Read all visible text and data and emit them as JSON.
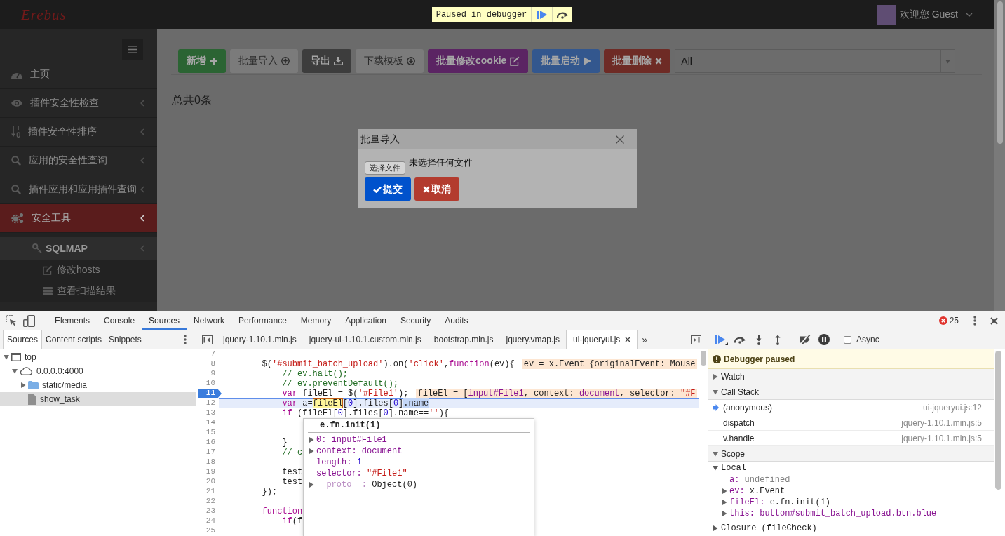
{
  "page": {
    "logo": "Erebus",
    "debugger_overlay": {
      "text": "Paused in debugger"
    },
    "user": {
      "greeting": "欢迎您 Guest"
    },
    "sidebar": {
      "items": [
        {
          "label": "主页",
          "kind": "link",
          "selected": false
        },
        {
          "label": "插件安全性检查",
          "kind": "menu",
          "selected": false
        },
        {
          "label": "插件安全性排序",
          "kind": "menu",
          "selected": false
        },
        {
          "label": "应用的安全性查询",
          "kind": "menu",
          "selected": false
        },
        {
          "label": "插件应用和应用插件查询",
          "kind": "menu",
          "selected": false
        },
        {
          "label": "安全工具",
          "kind": "menu",
          "selected": true,
          "children": [
            {
              "label": "SQLMAP",
              "kind": "menu",
              "selected": false,
              "children": [
                {
                  "label": "修改hosts",
                  "kind": "link",
                  "selected": false
                },
                {
                  "label": "查看扫描结果",
                  "kind": "link",
                  "selected": false
                }
              ]
            }
          ]
        }
      ]
    },
    "toolbar": {
      "buttons": [
        {
          "label": "新增",
          "kind": "solid",
          "color": "#2b6433"
        },
        {
          "label": "批量导入",
          "kind": "default",
          "color": "#7b7b7b"
        },
        {
          "label": "导出",
          "kind": "solid",
          "color": "#3d3d3d"
        },
        {
          "label": "下载模板",
          "kind": "default",
          "color": "#7b7b7b"
        },
        {
          "label": "批量修改cookie",
          "kind": "solid",
          "color": "#5b2463"
        },
        {
          "label": "批量启动",
          "kind": "solid",
          "color": "#33578e"
        },
        {
          "label": "批量删除",
          "kind": "solid",
          "color": "#6e2b25"
        }
      ],
      "filter": {
        "value": "All"
      }
    },
    "total": "总共0条",
    "dialog": {
      "title": "批量导入",
      "file_button": "选择文件",
      "file_status": "未选择任何文件",
      "buttons": [
        {
          "label": "提交",
          "color": "#0052cc"
        },
        {
          "label": "取消",
          "color": "#b33b2e"
        }
      ]
    }
  },
  "devtools": {
    "tabs": [
      {
        "label": "Elements",
        "selected": false
      },
      {
        "label": "Console",
        "selected": false
      },
      {
        "label": "Sources",
        "selected": true
      },
      {
        "label": "Network",
        "selected": false
      },
      {
        "label": "Performance",
        "selected": false
      },
      {
        "label": "Memory",
        "selected": false
      },
      {
        "label": "Application",
        "selected": false
      },
      {
        "label": "Security",
        "selected": false
      },
      {
        "label": "Audits",
        "selected": false
      }
    ],
    "error_count": "25",
    "navigator": {
      "tabs": [
        {
          "label": "Sources",
          "selected": true
        },
        {
          "label": "Content scripts",
          "selected": false
        },
        {
          "label": "Snippets",
          "selected": false
        }
      ],
      "tree": [
        {
          "label": "top",
          "kind": "frame",
          "expanded": true,
          "selected": false,
          "children": [
            {
              "label": "0.0.0.0:4000",
              "kind": "domain",
              "expanded": true,
              "selected": false,
              "children": [
                {
                  "label": "static/media",
                  "kind": "folder",
                  "expanded": false,
                  "selected": false
                },
                {
                  "label": "show_task",
                  "kind": "file",
                  "selected": true
                }
              ]
            }
          ]
        }
      ]
    },
    "editor": {
      "files": [
        {
          "label": "jquery-1.10.1.min.js",
          "selected": false
        },
        {
          "label": "jquery-ui-1.10.1.custom.min.js",
          "selected": false
        },
        {
          "label": "bootstrap.min.js",
          "selected": false
        },
        {
          "label": "jquery.vmap.js",
          "selected": false
        },
        {
          "label": "ui-jqueryui.js",
          "selected": true
        }
      ],
      "overflow": "»",
      "lines": [
        {
          "number": "7",
          "breakpoint": false,
          "current": false
        },
        {
          "number": "8",
          "breakpoint": false,
          "current": false,
          "code": [
            {
              "kind": "plain",
              "text": "        $("
            },
            {
              "kind": "string",
              "text": "'#submit_batch_upload'"
            },
            {
              "kind": "plain",
              "text": ").on("
            },
            {
              "kind": "string",
              "text": "'click'"
            },
            {
              "kind": "plain",
              "text": ","
            },
            {
              "kind": "keyword",
              "text": "function"
            },
            {
              "kind": "plain",
              "text": "(ev){"
            }
          ],
          "inline_value": [
            {
              "kind": "plain",
              "text": "ev = x.Event {originalEvent: Mouse"
            }
          ]
        },
        {
          "number": "9",
          "breakpoint": false,
          "current": false,
          "code": [
            {
              "kind": "comment",
              "text": "            // ev.halt();"
            }
          ]
        },
        {
          "number": "10",
          "breakpoint": false,
          "current": false,
          "code": [
            {
              "kind": "comment",
              "text": "            // ev.preventDefault();"
            }
          ]
        },
        {
          "number": "11",
          "breakpoint": true,
          "current": false,
          "code": [
            {
              "kind": "keyword",
              "text": "            var"
            },
            {
              "kind": "plain",
              "text": " fileEl = $("
            },
            {
              "kind": "string",
              "text": "'#File1'"
            },
            {
              "kind": "plain",
              "text": ");"
            }
          ],
          "inline_value": [
            {
              "kind": "plain",
              "text": "fileEl = ["
            },
            {
              "kind": "node",
              "text": "input#File1"
            },
            {
              "kind": "plain",
              "text": ", context: "
            },
            {
              "kind": "node",
              "text": "document"
            },
            {
              "kind": "plain",
              "text": ", selector: "
            },
            {
              "kind": "string",
              "text": "\"#F"
            }
          ]
        },
        {
          "number": "12",
          "breakpoint": false,
          "current": true,
          "code": [
            {
              "kind": "keyword",
              "text": "            var"
            },
            {
              "kind": "plain",
              "text": " a="
            },
            {
              "kind": "hovered",
              "text": "fileEl"
            },
            {
              "kind": "plain",
              "text": "["
            },
            {
              "kind": "number",
              "text": "0"
            },
            {
              "kind": "plain",
              "text": "].files["
            },
            {
              "kind": "number",
              "text": "0"
            },
            {
              "kind": "plain",
              "text": "]"
            },
            {
              "kind": "selection",
              "text": ".name"
            }
          ]
        },
        {
          "number": "13",
          "breakpoint": false,
          "current": false,
          "code": [
            {
              "kind": "keyword",
              "text": "            if"
            },
            {
              "kind": "plain",
              "text": " (fileEl["
            },
            {
              "kind": "number",
              "text": "0"
            },
            {
              "kind": "plain",
              "text": "].files["
            },
            {
              "kind": "number",
              "text": "0"
            },
            {
              "kind": "plain",
              "text": "].name=="
            },
            {
              "kind": "string",
              "text": "''"
            },
            {
              "kind": "plain",
              "text": "){"
            }
          ]
        },
        {
          "number": "14",
          "breakpoint": false,
          "current": false
        },
        {
          "number": "15",
          "breakpoint": false,
          "current": false
        },
        {
          "number": "16",
          "breakpoint": false,
          "current": false,
          "code": [
            {
              "kind": "plain",
              "text": "            }"
            }
          ]
        },
        {
          "number": "17",
          "breakpoint": false,
          "current": false,
          "code": [
            {
              "kind": "comment",
              "text": "            // c"
            }
          ]
        },
        {
          "number": "18",
          "breakpoint": false,
          "current": false
        },
        {
          "number": "19",
          "breakpoint": false,
          "current": false,
          "code": [
            {
              "kind": "plain",
              "text": "            test"
            }
          ]
        },
        {
          "number": "20",
          "breakpoint": false,
          "current": false,
          "code": [
            {
              "kind": "plain",
              "text": "            test"
            }
          ]
        },
        {
          "number": "21",
          "breakpoint": false,
          "current": false,
          "code": [
            {
              "kind": "plain",
              "text": "        });"
            }
          ]
        },
        {
          "number": "22",
          "breakpoint": false,
          "current": false
        },
        {
          "number": "23",
          "breakpoint": false,
          "current": false,
          "code": [
            {
              "kind": "keyword",
              "text": "        function"
            }
          ]
        },
        {
          "number": "24",
          "breakpoint": false,
          "current": false,
          "code": [
            {
              "kind": "keyword",
              "text": "            if"
            },
            {
              "kind": "plain",
              "text": "(f"
            }
          ]
        },
        {
          "number": "25",
          "breakpoint": false,
          "current": false
        }
      ],
      "popover": {
        "title": "e.fn.init(1)",
        "entries": [
          {
            "key": "0:",
            "value": "input#File1",
            "kind": "node",
            "expandable": true,
            "internal": false
          },
          {
            "key": "context:",
            "value": "document",
            "kind": "node",
            "expandable": true,
            "internal": false
          },
          {
            "key": "length:",
            "value": "1",
            "kind": "number",
            "expandable": false,
            "internal": false
          },
          {
            "key": "selector:",
            "value": "\"#File1\"",
            "kind": "string",
            "expandable": false,
            "internal": false
          },
          {
            "key": "__proto__:",
            "value": "Object(0)",
            "kind": "object",
            "expandable": true,
            "internal": true
          }
        ]
      }
    },
    "debugger": {
      "async": {
        "label": "Async",
        "checked": false
      },
      "banner": "Debugger paused",
      "watch": {
        "title": "Watch",
        "expanded": false
      },
      "call_stack": {
        "title": "Call Stack",
        "expanded": true,
        "frames": [
          {
            "name": "(anonymous)",
            "location": "ui-jqueryui.js:12",
            "selected": true
          },
          {
            "name": "dispatch",
            "location": "jquery-1.10.1.min.js:5",
            "selected": false
          },
          {
            "name": "v.handle",
            "location": "jquery-1.10.1.min.js:5",
            "selected": false
          }
        ]
      },
      "scope": {
        "title": "Scope",
        "expanded": true,
        "groups": [
          {
            "title": "Local",
            "expanded": true,
            "entries": [
              {
                "key": "a:",
                "value": "undefined",
                "kind": "undefined",
                "expandable": false
              },
              {
                "key": "ev:",
                "value": "x.Event",
                "kind": "object",
                "expandable": true
              },
              {
                "key": "fileEl:",
                "value": "e.fn.init(1)",
                "kind": "object",
                "expandable": true
              },
              {
                "key": "this:",
                "value": "button#submit_batch_upload.btn.blue",
                "kind": "node",
                "expandable": true
              }
            ]
          },
          {
            "title": "Closure (fileCheck)",
            "expanded": false
          }
        ]
      }
    }
  }
}
